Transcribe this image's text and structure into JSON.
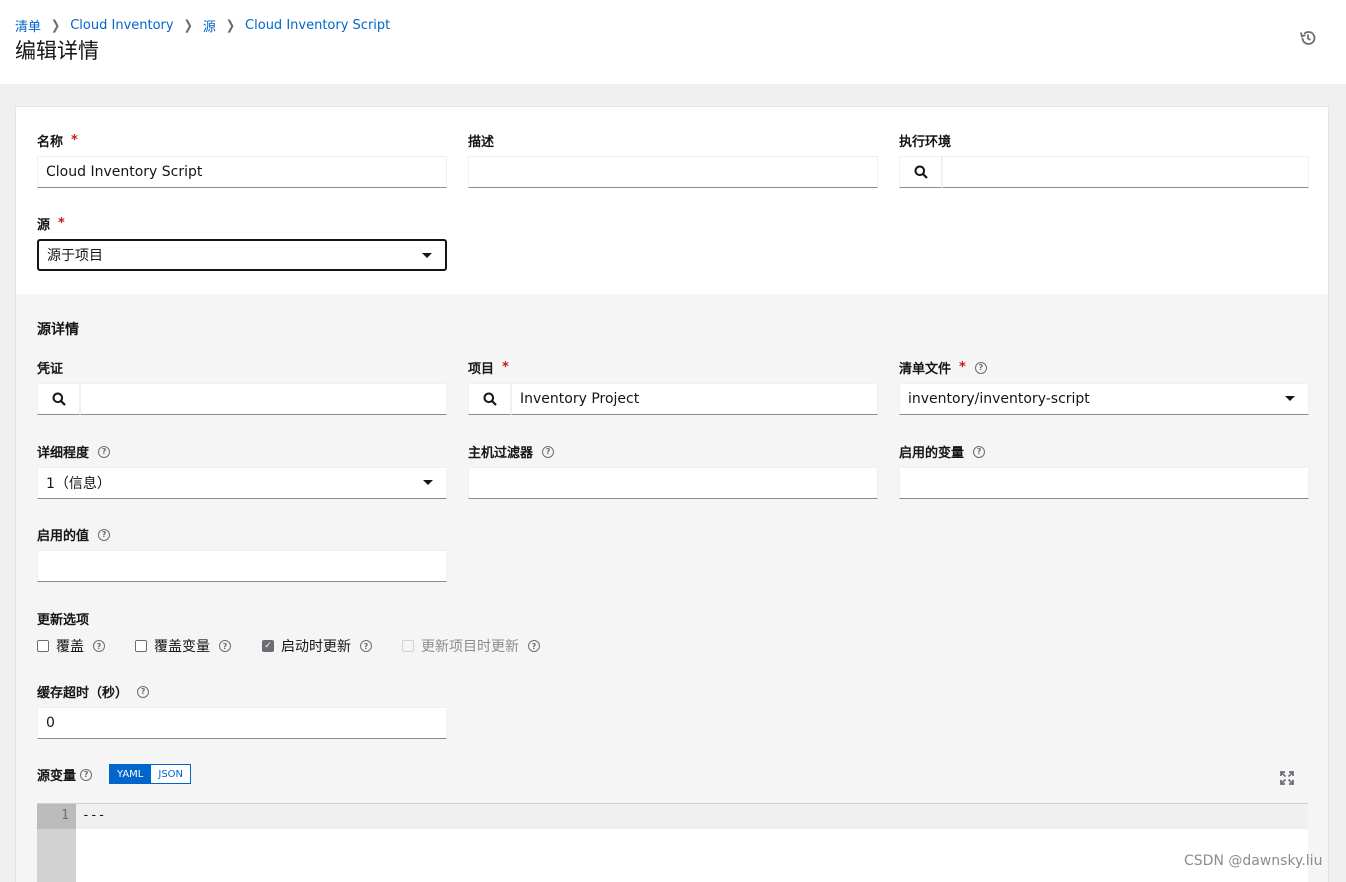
{
  "breadcrumb": {
    "items": [
      "清单",
      "Cloud Inventory",
      "源",
      "Cloud Inventory Script"
    ]
  },
  "page_title": "编辑详情",
  "form": {
    "name": {
      "label": "名称",
      "value": "Cloud Inventory Script"
    },
    "description": {
      "label": "描述",
      "value": ""
    },
    "execution_env": {
      "label": "执行环境",
      "value": ""
    },
    "source": {
      "label": "源",
      "value": "源于项目"
    }
  },
  "source_details": {
    "title": "源详情",
    "credential": {
      "label": "凭证",
      "value": ""
    },
    "project": {
      "label": "项目",
      "value": "Inventory Project"
    },
    "inventory_file": {
      "label": "清单文件",
      "value": "inventory/inventory-script"
    },
    "verbosity": {
      "label": "详细程度",
      "value": "1（信息）"
    },
    "host_filter": {
      "label": "主机过滤器",
      "value": ""
    },
    "enabled_variable": {
      "label": "启用的变量",
      "value": ""
    },
    "enabled_value": {
      "label": "启用的值",
      "value": ""
    },
    "update_options": {
      "label": "更新选项",
      "overwrite": {
        "label": "覆盖",
        "checked": false
      },
      "overwrite_vars": {
        "label": "覆盖变量",
        "checked": false
      },
      "update_on_launch": {
        "label": "启动时更新",
        "checked": true
      },
      "update_on_project_update": {
        "label": "更新项目时更新",
        "checked": false,
        "disabled": true
      }
    },
    "cache_timeout": {
      "label": "缓存超时（秒）",
      "value": "0"
    },
    "source_vars": {
      "label": "源变量",
      "yaml": "YAML",
      "json": "JSON",
      "line_number": "1",
      "code": "---"
    }
  },
  "watermark": "CSDN @dawnsky.liu",
  "icons": [
    "history-icon",
    "search-icon",
    "caret-down-icon",
    "help-icon",
    "expand-icon"
  ],
  "colors": {
    "link": "#0066cc",
    "required": "#c9190b",
    "toggle_active": "#0066cc"
  }
}
